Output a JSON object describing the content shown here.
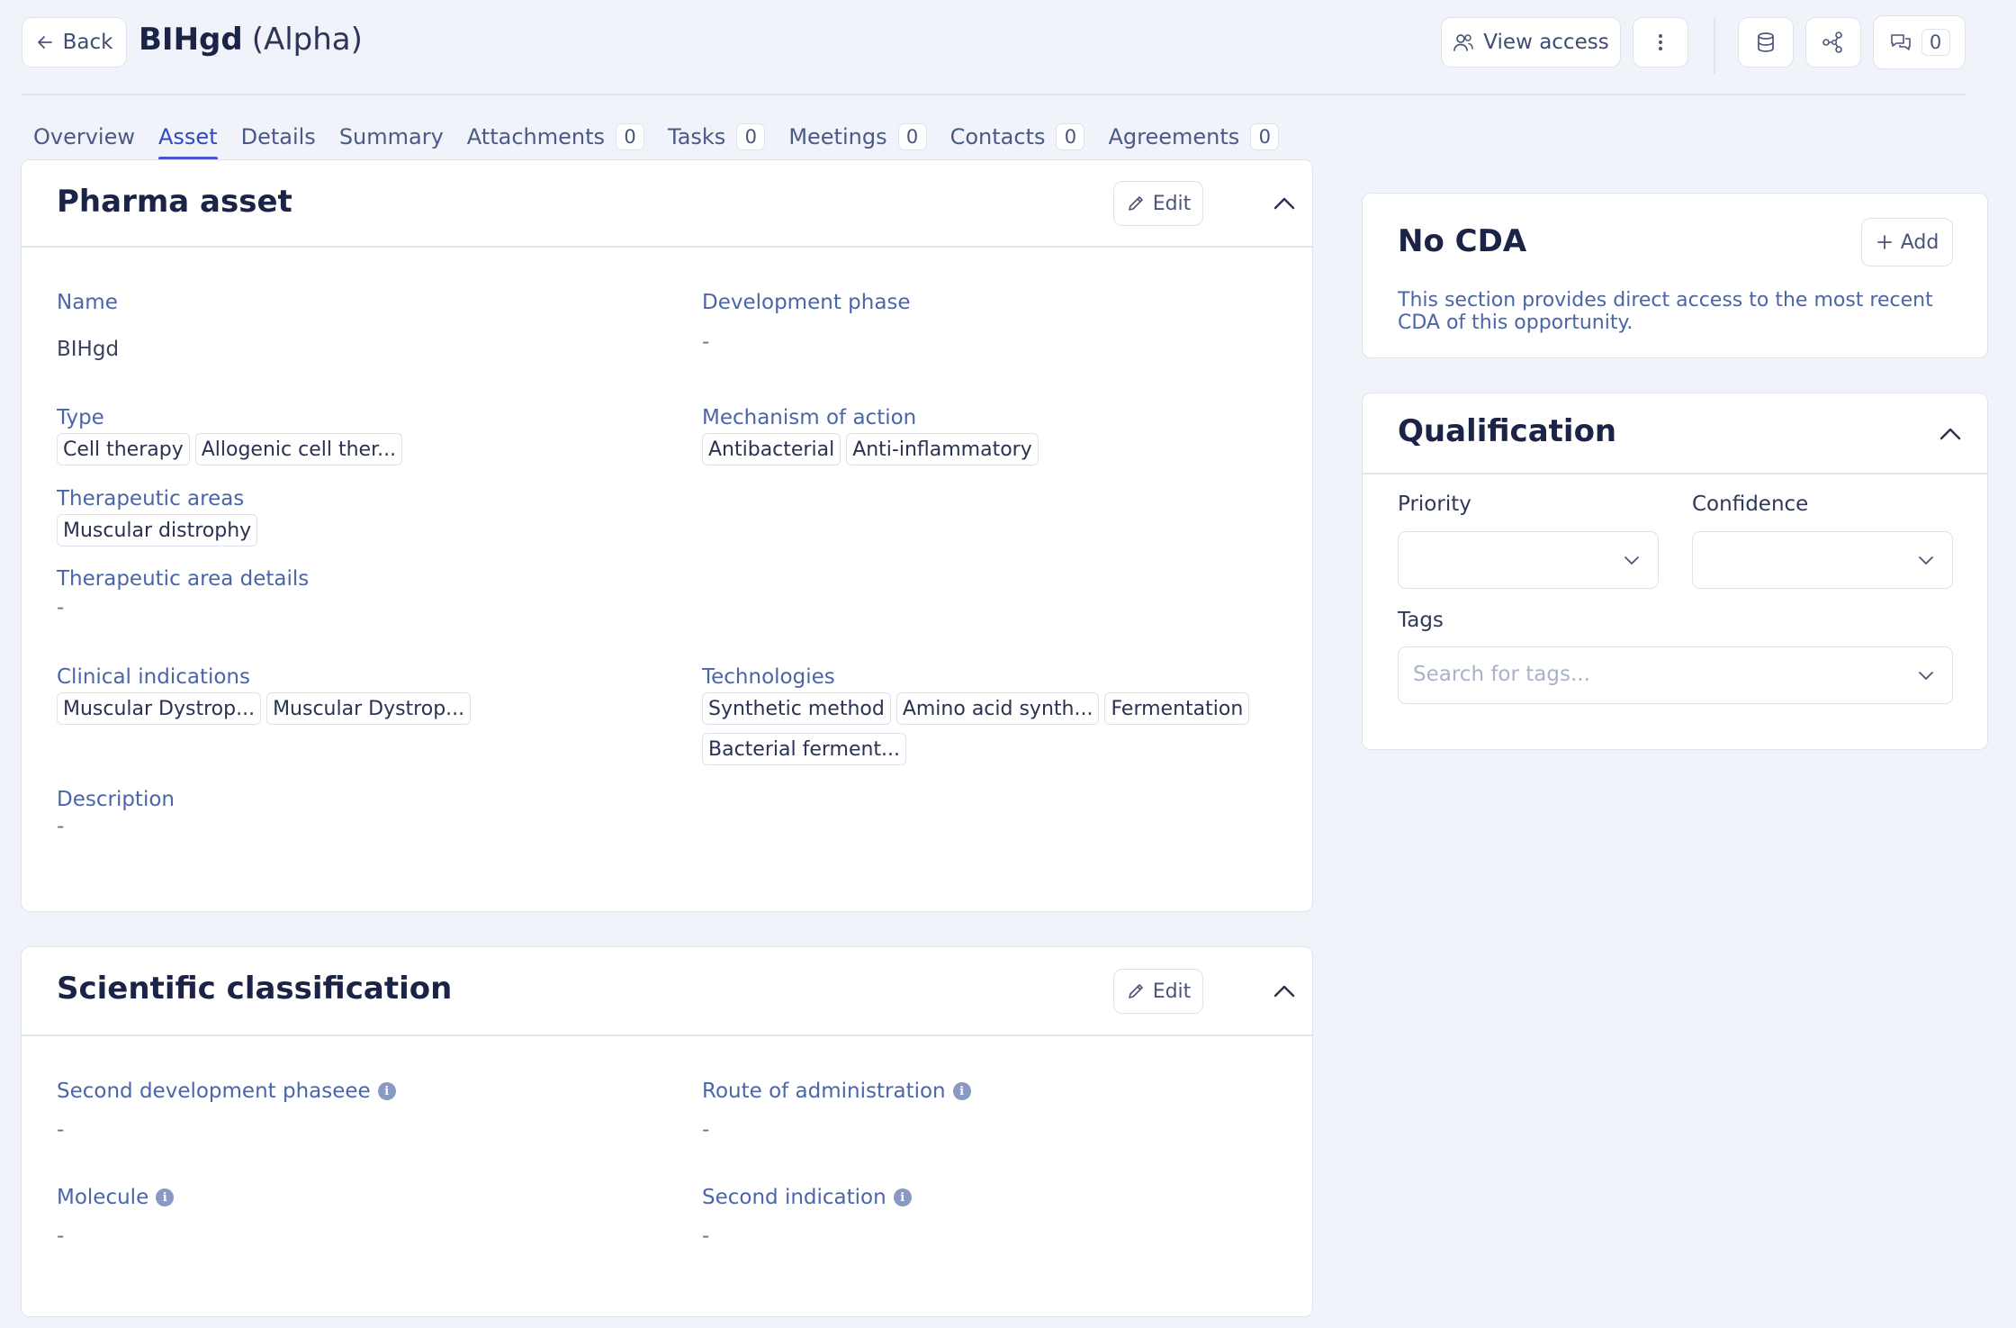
{
  "header": {
    "back_label": "Back",
    "title": "BIHgd",
    "subtitle": "(Alpha)",
    "view_access_label": "View access",
    "comments_count": "0"
  },
  "tabs": [
    {
      "label": "Overview",
      "count": null
    },
    {
      "label": "Asset",
      "count": null,
      "active": true
    },
    {
      "label": "Details",
      "count": null
    },
    {
      "label": "Summary",
      "count": null
    },
    {
      "label": "Attachments",
      "count": "0"
    },
    {
      "label": "Tasks",
      "count": "0"
    },
    {
      "label": "Meetings",
      "count": "0"
    },
    {
      "label": "Contacts",
      "count": "0"
    },
    {
      "label": "Agreements",
      "count": "0"
    }
  ],
  "pharma_asset": {
    "title": "Pharma asset",
    "edit_label": "Edit",
    "name_label": "Name",
    "name_value": "BIHgd",
    "development_phase_label": "Development phase",
    "development_phase_value": "-",
    "type_label": "Type",
    "type_chips": [
      "Cell therapy",
      "Allogenic cell ther..."
    ],
    "mechanism_label": "Mechanism of action",
    "mechanism_chips": [
      "Antibacterial",
      "Anti-inflammatory"
    ],
    "therapeutic_areas_label": "Therapeutic areas",
    "therapeutic_areas_chips": [
      "Muscular distrophy"
    ],
    "therapeutic_area_details_label": "Therapeutic area details",
    "therapeutic_area_details_value": "-",
    "clinical_indications_label": "Clinical indications",
    "clinical_indications_chips": [
      "Muscular Dystrop...",
      "Muscular Dystrop..."
    ],
    "technologies_label": "Technologies",
    "technologies_chips": [
      "Synthetic method",
      "Amino acid synth...",
      "Fermentation",
      "Bacterial ferment..."
    ],
    "description_label": "Description",
    "description_value": "-"
  },
  "scientific": {
    "title": "Scientific classification",
    "edit_label": "Edit",
    "second_phase_label": "Second development phaseee",
    "second_phase_value": "-",
    "route_label": "Route of administration",
    "route_value": "-",
    "molecule_label": "Molecule",
    "molecule_value": "-",
    "second_indication_label": "Second indication",
    "second_indication_value": "-"
  },
  "cda": {
    "title": "No CDA",
    "add_label": "Add",
    "description": "This section provides direct access to the most recent CDA of this opportunity."
  },
  "qualification": {
    "title": "Qualification",
    "priority_label": "Priority",
    "confidence_label": "Confidence",
    "tags_label": "Tags",
    "tags_placeholder": "Search for tags..."
  },
  "colors": {
    "accent": "#4355d6",
    "label": "#4a65a8",
    "title": "#1b2346",
    "background": "#f0f3f9"
  }
}
